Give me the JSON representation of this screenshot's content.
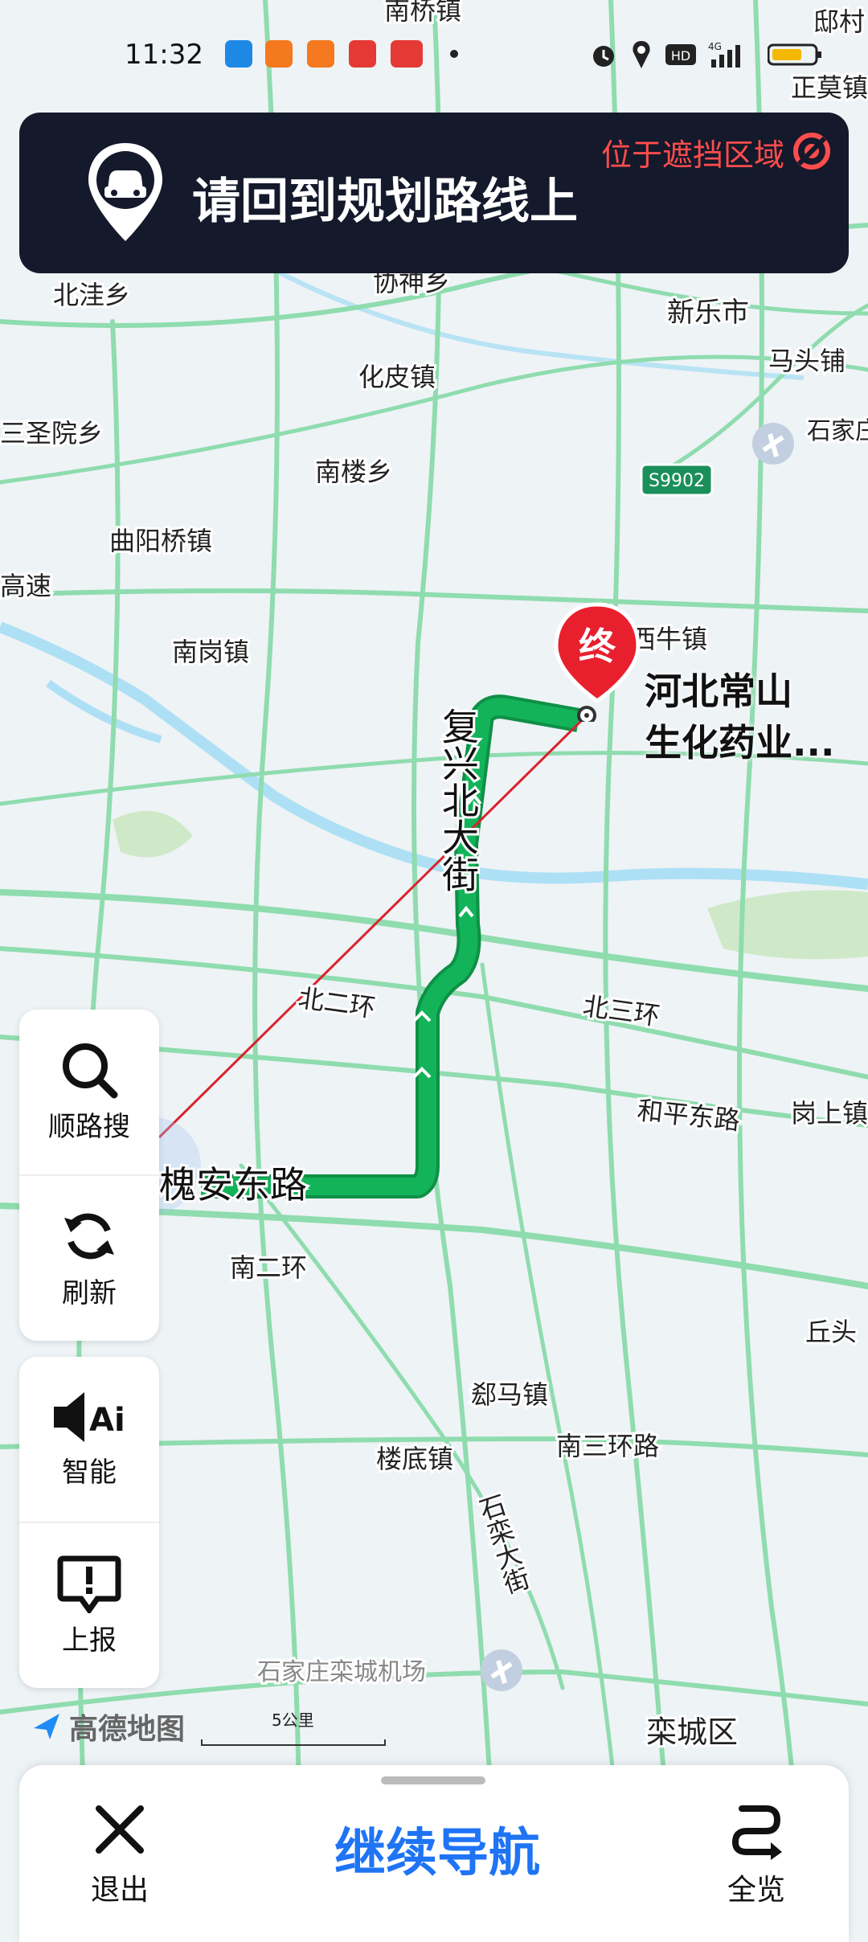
{
  "status_bar": {
    "time": "11:32",
    "signal": "4G"
  },
  "banner": {
    "title": "请回到规划路线上",
    "warning": "位于遮挡区域"
  },
  "map_labels": [
    {
      "id": "nanqiao",
      "text": "南桥镇"
    },
    {
      "id": "qiu",
      "text": "邸村"
    },
    {
      "id": "zhengmo",
      "text": "正莫镇"
    },
    {
      "id": "beiwa",
      "text": "北洼乡"
    },
    {
      "id": "xiesheng",
      "text": "协神乡"
    },
    {
      "id": "xinle",
      "text": "新乐市"
    },
    {
      "id": "matou",
      "text": "马头铺"
    },
    {
      "id": "huapi",
      "text": "化皮镇"
    },
    {
      "id": "sansheng",
      "text": "三圣院乡"
    },
    {
      "id": "nanlou",
      "text": "南楼乡"
    },
    {
      "id": "airport1",
      "text": "石家庄国际"
    },
    {
      "id": "quyangqiao",
      "text": "曲阳桥镇"
    },
    {
      "id": "gaosu",
      "text": "高速"
    },
    {
      "id": "nangang",
      "text": "南岗镇"
    },
    {
      "id": "xiniu",
      "text": "西牛镇"
    },
    {
      "id": "fuxing",
      "text": "复兴北大街"
    },
    {
      "id": "beierhuan",
      "text": "北二环"
    },
    {
      "id": "beisanhuan",
      "text": "北三环"
    },
    {
      "id": "hepingdong",
      "text": "和平东路"
    },
    {
      "id": "gangshang",
      "text": "岗上镇"
    },
    {
      "id": "huaiandong",
      "text": "槐安东路"
    },
    {
      "id": "nanerhuan",
      "text": "南二环"
    },
    {
      "id": "qiutou",
      "text": "丘头"
    },
    {
      "id": "chima",
      "text": "郄马镇"
    },
    {
      "id": "nansanhuan",
      "text": "南三环路"
    },
    {
      "id": "loudi",
      "text": "楼底镇"
    },
    {
      "id": "shiluan",
      "text": "石栾大街"
    },
    {
      "id": "luancheng_airport",
      "text": "石家庄栾城机场"
    },
    {
      "id": "luancheng",
      "text": "栾城区"
    }
  ],
  "highway_badge": "S9902",
  "destination": {
    "marker": "终",
    "name_line1": "河北常山",
    "name_line2": "生化药业..."
  },
  "side_panel_top": [
    {
      "label": "顺路搜",
      "icon": "search-icon"
    },
    {
      "label": "刷新",
      "icon": "refresh-icon"
    }
  ],
  "side_panel_bottom": [
    {
      "label": "智能",
      "icon": "ai-voice-icon"
    },
    {
      "label": "上报",
      "icon": "report-icon"
    }
  ],
  "map_brand": {
    "name": "高德地图",
    "scale": "5公里"
  },
  "bottom_bar": {
    "exit": "退出",
    "continue": "继续导航",
    "overview": "全览"
  },
  "colors": {
    "route": "#13b35a",
    "banner_bg": "#14192b",
    "accent": "#1f74f5",
    "warning": "#ff4d4d",
    "road": "#8fdcae",
    "water": "#aee0f5"
  }
}
